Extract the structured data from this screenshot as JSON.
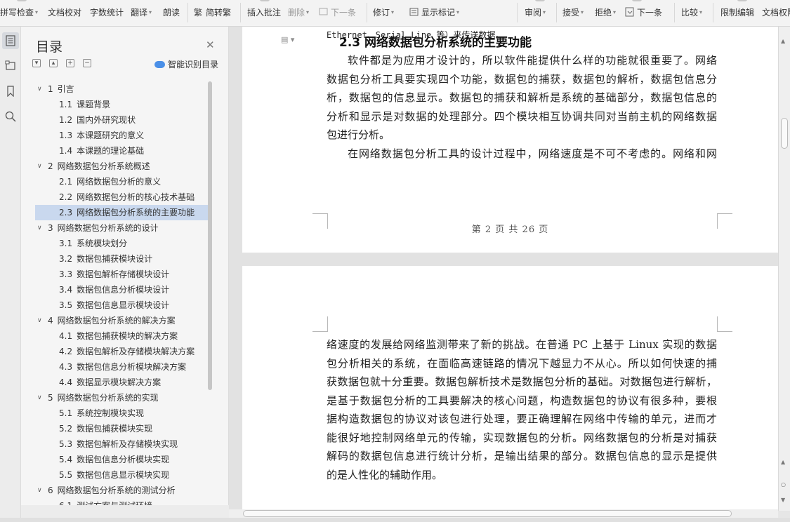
{
  "ribbon": {
    "spellcheck": "拼写检查",
    "doc_proof": "文档校对",
    "word_count": "字数统计",
    "translate": "翻译",
    "read_aloud": "朗读",
    "convert": "简转繁",
    "insert_comment": "插入批注",
    "delete": "删除",
    "next_comment": "下一条",
    "revise": "修订",
    "show_markup": "显示标记",
    "review": "审阅",
    "accept": "接受",
    "reject": "拒绝",
    "next_change": "下一条",
    "compare": "比较",
    "restrict_edit": "限制编辑",
    "doc_permission": "文档权限"
  },
  "toc": {
    "title": "目录",
    "smart_label": "智能识别目录",
    "items": [
      {
        "num": "1",
        "text": "引言",
        "level": 1
      },
      {
        "num": "1.1",
        "text": "课题背景",
        "level": 2
      },
      {
        "num": "1.2",
        "text": "国内外研究现状",
        "level": 2
      },
      {
        "num": "1.3",
        "text": "本课题研究的意义",
        "level": 2
      },
      {
        "num": "1.4",
        "text": "本课题的理论基础",
        "level": 2
      },
      {
        "num": "2",
        "text": "网络数据包分析系统概述",
        "level": 1
      },
      {
        "num": "2.1",
        "text": "网络数据包分析的意义",
        "level": 2
      },
      {
        "num": "2.2",
        "text": "网络数据包分析的核心技术基础",
        "level": 2
      },
      {
        "num": "2.3",
        "text": "网络数据包分析系统的主要功能",
        "level": 2,
        "selected": true
      },
      {
        "num": "3",
        "text": "网络数据包分析系统的设计",
        "level": 1
      },
      {
        "num": "3.1",
        "text": "系统模块划分",
        "level": 2
      },
      {
        "num": "3.2",
        "text": "数据包捕获模块设计",
        "level": 2
      },
      {
        "num": "3.3",
        "text": "数据包解析存储模块设计",
        "level": 2
      },
      {
        "num": "3.4",
        "text": "数据包信息分析模块设计",
        "level": 2
      },
      {
        "num": "3.5",
        "text": "数据包信息显示模块设计",
        "level": 2
      },
      {
        "num": "4",
        "text": "网络数据包分析系统的解决方案",
        "level": 1
      },
      {
        "num": "4.1",
        "text": "数据包捕获模块的解决方案",
        "level": 2
      },
      {
        "num": "4.2",
        "text": "数据包解析及存储模块解决方案",
        "level": 2
      },
      {
        "num": "4.3",
        "text": "数据包信息分析模块解决方案",
        "level": 2
      },
      {
        "num": "4.4",
        "text": "数据显示模块解决方案",
        "level": 2
      },
      {
        "num": "5",
        "text": "网络数据包分析系统的实现",
        "level": 1
      },
      {
        "num": "5.1",
        "text": "系统控制模块实现",
        "level": 2
      },
      {
        "num": "5.2",
        "text": "数据包捕获模块实现",
        "level": 2
      },
      {
        "num": "5.3",
        "text": "数据包解析及存储模块实现",
        "level": 2
      },
      {
        "num": "5.4",
        "text": "数据包信息分析模块实现",
        "level": 2
      },
      {
        "num": "5.5",
        "text": "数据包信息显示模块实现",
        "level": 2
      },
      {
        "num": "6",
        "text": "网络数据包分析系统的测试分析",
        "level": 1
      },
      {
        "num": "6.1",
        "text": "测试方案与测试环境",
        "level": 2
      }
    ]
  },
  "document": {
    "top_cut_text": "Ethernet、Serial Line 等）来传送数据。",
    "heading": "2.3  网络数据包分析系统的主要功能",
    "page1_lines": [
      {
        "text": "软件都是为应用才设计的，所以软件能提供什么样的功能就很重要了。网络",
        "indent": true
      },
      {
        "text": "数据包分析工具要实现四个功能，数据包的捕获，数据包的解析，数据包信息分"
      },
      {
        "text": "析，数据包的信息显示。数据包的捕获和解析是系统的基础部分，数据包信息的"
      },
      {
        "text": "分析和显示是对数据的处理部分。四个模块相互协调共同对当前主机的网络数据"
      },
      {
        "text": "包进行分析。",
        "last": true
      },
      {
        "text": "在网络数据包分析工具的设计过程中，网络速度是不可不考虑的。网络和网",
        "indent": true
      }
    ],
    "footer": "第 2 页 共 26 页",
    "page2_lines": [
      {
        "text": "络速度的发展给网络监测带来了新的挑战。在普通 PC 上基于 Linux 实现的数据"
      },
      {
        "text": "包分析相关的系统，在面临高速链路的情况下越显力不从心。所以如何快速的捕"
      },
      {
        "text": "获数据包就十分重要。数据包解析技术是数据包分析的基础。对数据包进行解析，"
      },
      {
        "text": "是基于数据包分析的工具要解决的核心问题，构造数据包的协议有很多种，要根"
      },
      {
        "text": "据构造数据包的协议对该包进行处理，要正确理解在网络中传输的单元，进而才"
      },
      {
        "text": "能很好地控制网络单元的传输，实现数据包的分析。网络数据包的分析是对捕获"
      },
      {
        "text": "解码的数据包信息进行统计分析，是输出结果的部分。数据包信息的显示是提供"
      },
      {
        "text": "的是人性化的辅助作用。",
        "last": true
      }
    ]
  },
  "colors": {
    "selection": "#c9d8ee",
    "smart_icon": "#4a8fe7"
  }
}
